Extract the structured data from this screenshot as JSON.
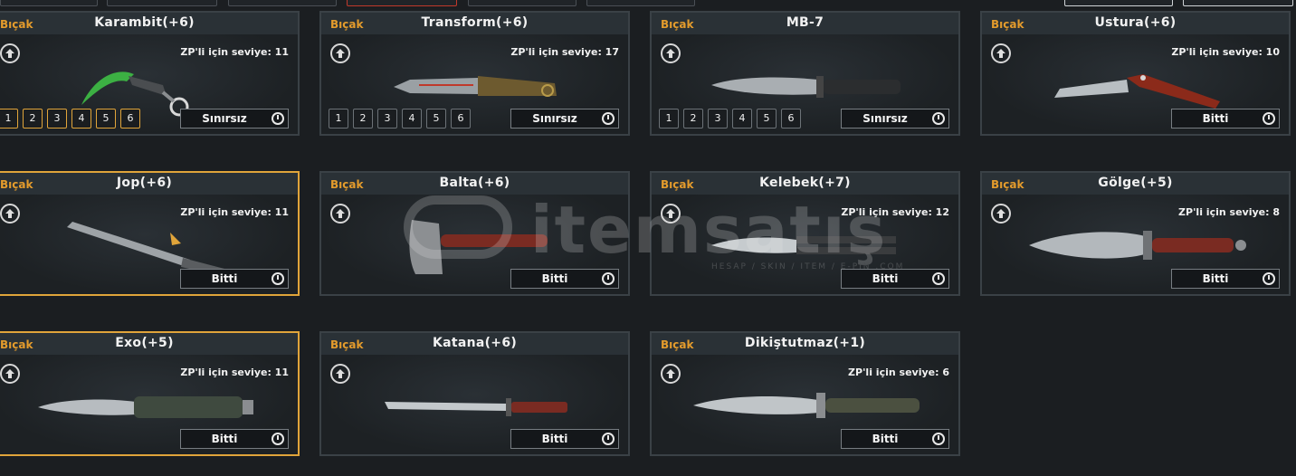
{
  "cards": [
    {
      "category": "Bıçak",
      "name": "Karambit(+6)",
      "zp": "ZP'li için seviye: 11",
      "duration": "Sınırsız",
      "levels": [
        "1",
        "2",
        "3",
        "4",
        "5",
        "6"
      ],
      "selected": false
    },
    {
      "category": "Bıçak",
      "name": "Transform(+6)",
      "zp": "ZP'li için seviye: 17",
      "duration": "Sınırsız",
      "levels": [
        "1",
        "2",
        "3",
        "4",
        "5",
        "6"
      ],
      "selected": false
    },
    {
      "category": "Bıçak",
      "name": "MB-7",
      "zp": "",
      "duration": "Sınırsız",
      "levels": [
        "1",
        "2",
        "3",
        "4",
        "5",
        "6"
      ],
      "selected": false
    },
    {
      "category": "Bıçak",
      "name": "Ustura(+6)",
      "zp": "ZP'li için seviye: 10",
      "duration": "Bitti",
      "levels": [],
      "selected": false
    },
    {
      "category": "Bıçak",
      "name": "Jop(+6)",
      "zp": "ZP'li için seviye: 11",
      "duration": "Bitti",
      "levels": [],
      "selected": true
    },
    {
      "category": "Bıçak",
      "name": "Balta(+6)",
      "zp": "",
      "duration": "Bitti",
      "levels": [],
      "selected": false
    },
    {
      "category": "Bıçak",
      "name": "Kelebek(+7)",
      "zp": "ZP'li için seviye: 12",
      "duration": "Bitti",
      "levels": [],
      "selected": false
    },
    {
      "category": "Bıçak",
      "name": "Gölge(+5)",
      "zp": "ZP'li için seviye: 8",
      "duration": "Bitti",
      "levels": [],
      "selected": false
    },
    {
      "category": "Bıçak",
      "name": "Exo(+5)",
      "zp": "ZP'li için seviye: 11",
      "duration": "Bitti",
      "levels": [],
      "selected": true
    },
    {
      "category": "Bıçak",
      "name": "Katana(+6)",
      "zp": "",
      "duration": "Bitti",
      "levels": [],
      "selected": false
    },
    {
      "category": "Bıçak",
      "name": "Dikiştutmaz(+1)",
      "zp": "ZP'li için seviye: 6",
      "duration": "Bitti",
      "levels": [],
      "selected": false
    }
  ],
  "watermark": {
    "text": "itemsatış",
    "sub": "HESAP / SKIN / ITEM / E-PIN .COM"
  },
  "colors": {
    "accent": "#e39b2c",
    "selected_border": "#e0a43a",
    "card_border": "#3a4146"
  }
}
